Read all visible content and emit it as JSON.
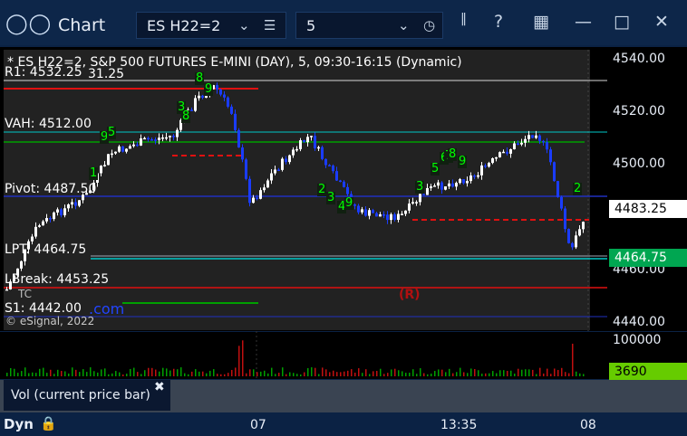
{
  "window": {
    "title": "Chart",
    "app_icon": "chart-grid-icon",
    "symbol": "ES H22=2",
    "interval": "5"
  },
  "chart_header": "* ES H22=2, S&P 500 FUTURES E-MINI (DAY), 5, 09:30-16:15 (Dynamic)",
  "levels": {
    "r1": "R1: 4532.25",
    "r1_extra": "31.25",
    "vah": "VAH: 4512.00",
    "pivot": "Pivot: 4487.50",
    "lpt": "LPT: 4464.75",
    "lbreak": "LBreak: 4453.25",
    "s1": "S1: 4442.00",
    "tc": "TC",
    "r_marker": "(R)"
  },
  "watermark": "© eSignal, 2022",
  "watermark_com": ".com",
  "price_axis": {
    "ticks": [
      "4540.00",
      "4520.00",
      "4500.00",
      "4480.00",
      "4460.00",
      "4440.00"
    ],
    "last_price": "4483.25",
    "lpt_badge": "4464.75",
    "last_price_bg": "#ffffff",
    "lpt_badge_bg": "#00a651"
  },
  "volume_axis": {
    "ticks": [
      "100000"
    ],
    "current_volume": "3690",
    "current_volume_bg": "#66cc00"
  },
  "indicator_tab": {
    "label": "Vol (current price bar)"
  },
  "time_axis": {
    "mode": "Dyn",
    "labels": [
      "07",
      "13:35",
      "08"
    ]
  },
  "td_markers": [
    "8",
    "9",
    "3",
    "8",
    "9",
    "5",
    "1",
    "2",
    "3",
    "4",
    "9",
    "3",
    "5",
    "6",
    "7",
    "8",
    "9",
    "2"
  ],
  "colors": {
    "up_candle": "#ffffff",
    "down_candle": "#1a3cff",
    "resistance": "#e01010",
    "value_area": "#00c8c8",
    "pivot": "#2030c0",
    "support": "#00a000",
    "td_count": "#00ff00"
  }
}
